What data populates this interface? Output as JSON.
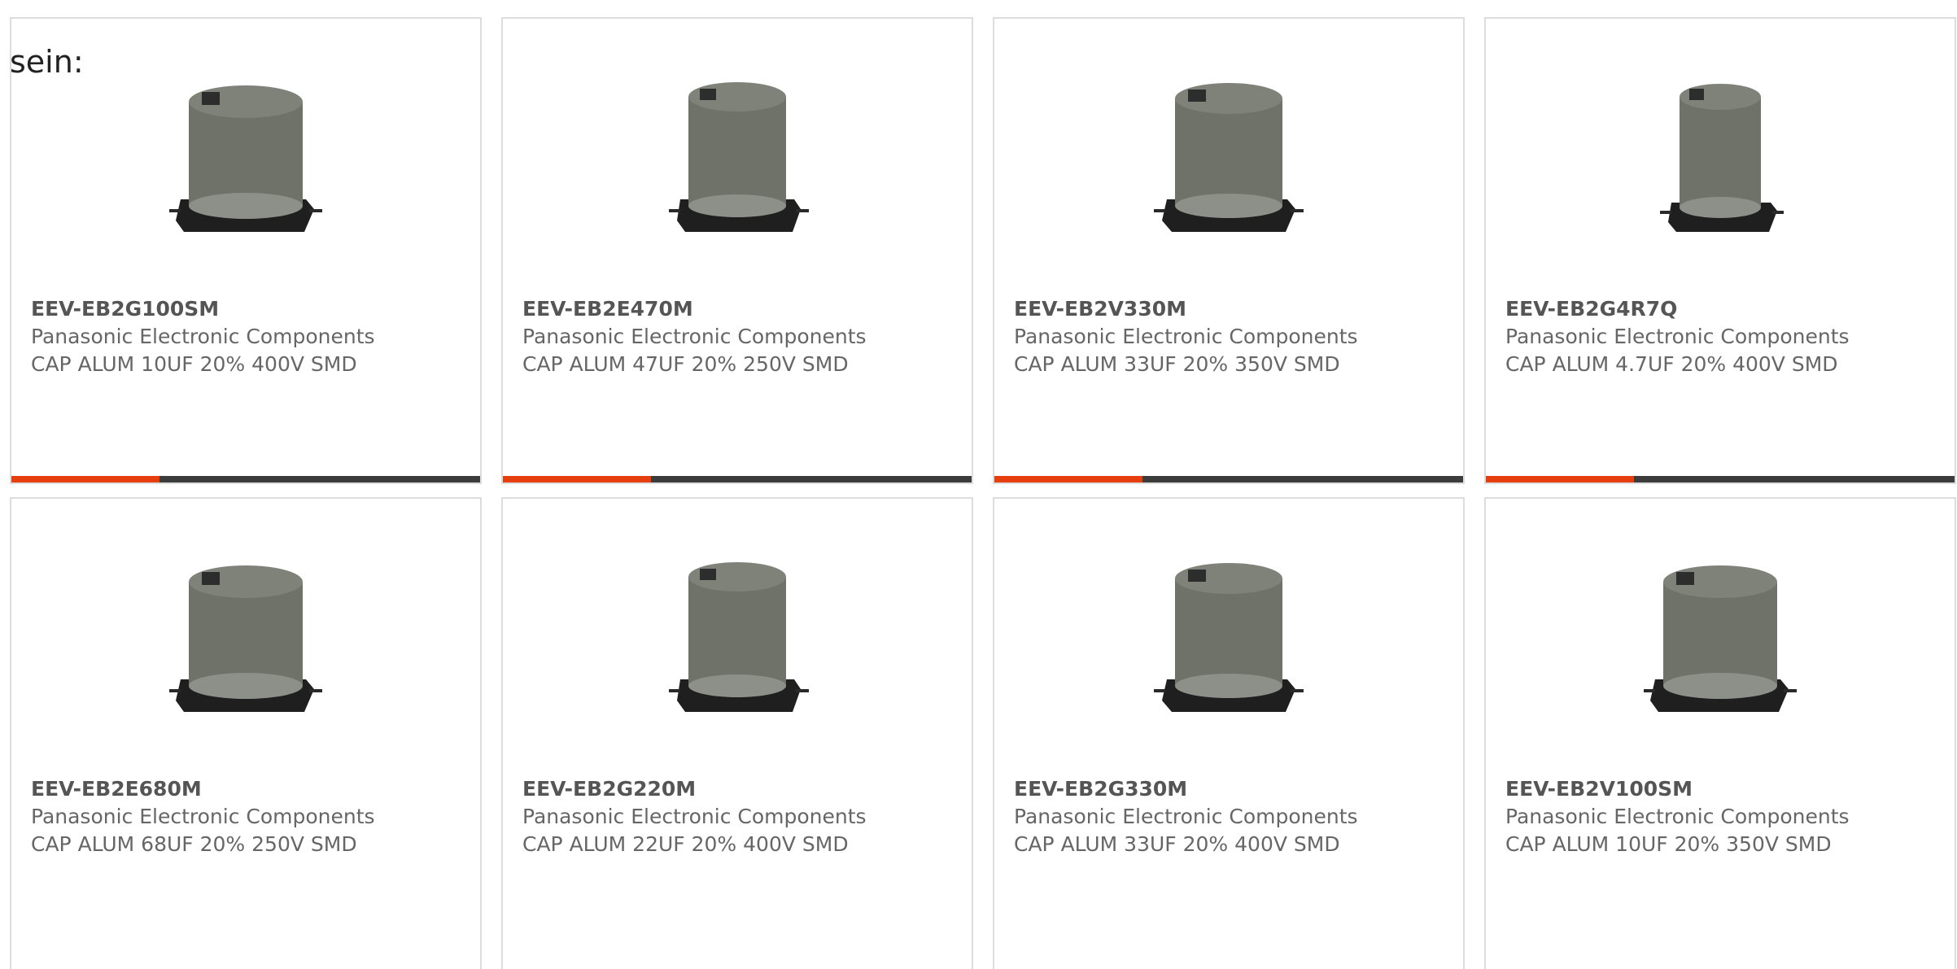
{
  "intro_text": "sein:",
  "colors": {
    "accent": "#e53f0f",
    "bar": "#3c3c3c",
    "border": "#dddddd",
    "text": "#666666"
  },
  "products": [
    {
      "part_number": "EEV-EB2G100SM",
      "manufacturer": "Panasonic Electronic Components",
      "description": "CAP ALUM 10UF 20% 400V SMD",
      "image_icon": "capacitor-icon"
    },
    {
      "part_number": "EEV-EB2E470M",
      "manufacturer": "Panasonic Electronic Components",
      "description": "CAP ALUM 47UF 20% 250V SMD",
      "image_icon": "capacitor-icon"
    },
    {
      "part_number": "EEV-EB2V330M",
      "manufacturer": "Panasonic Electronic Components",
      "description": "CAP ALUM 33UF 20% 350V SMD",
      "image_icon": "capacitor-icon"
    },
    {
      "part_number": "EEV-EB2G4R7Q",
      "manufacturer": "Panasonic Electronic Components",
      "description": "CAP ALUM 4.7UF 20% 400V SMD",
      "image_icon": "capacitor-icon"
    },
    {
      "part_number": "EEV-EB2E680M",
      "manufacturer": "Panasonic Electronic Components",
      "description": "CAP ALUM 68UF 20% 250V SMD",
      "image_icon": "capacitor-icon"
    },
    {
      "part_number": "EEV-EB2G220M",
      "manufacturer": "Panasonic Electronic Components",
      "description": "CAP ALUM 22UF 20% 400V SMD",
      "image_icon": "capacitor-icon"
    },
    {
      "part_number": "EEV-EB2G330M",
      "manufacturer": "Panasonic Electronic Components",
      "description": "CAP ALUM 33UF 20% 400V SMD",
      "image_icon": "capacitor-icon"
    },
    {
      "part_number": "EEV-EB2V100SM",
      "manufacturer": "Panasonic Electronic Components",
      "description": "CAP ALUM 10UF 20% 350V SMD",
      "image_icon": "capacitor-icon"
    }
  ]
}
